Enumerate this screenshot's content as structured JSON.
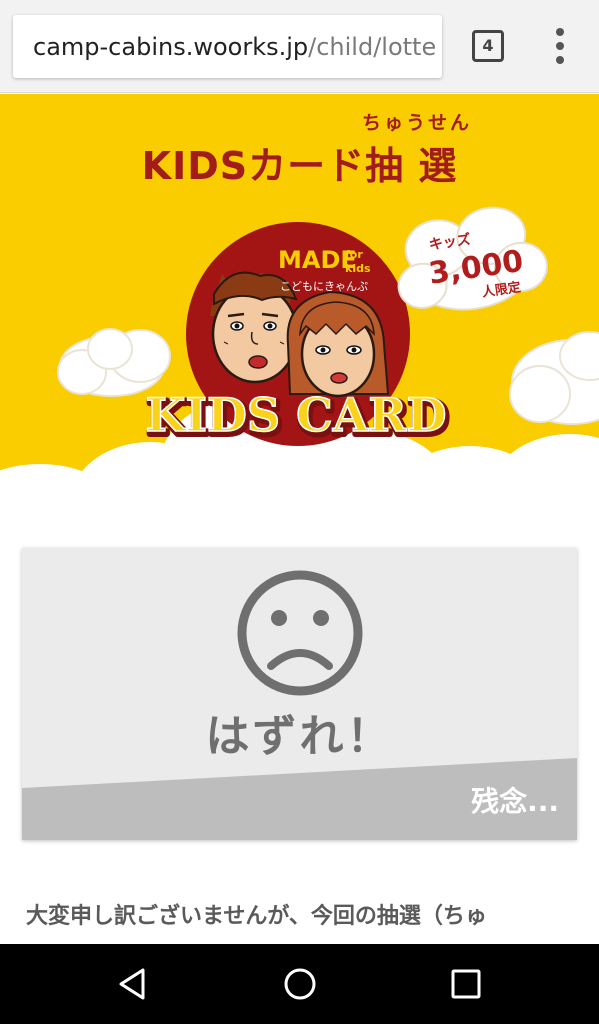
{
  "browser": {
    "url_host": "camp-cabins.woorks.jp",
    "url_path": "/child/lotte",
    "tab_count": "4"
  },
  "header": {
    "title": "KIDSカード抽 選",
    "title_ruby": "ちゅうせん"
  },
  "badge": {
    "made": "MADE",
    "for": "for",
    "kids": "kids",
    "kana": "こどもにきゃんぷ",
    "card_label": "KIDS CARD",
    "limit_top": "キッズ",
    "limit_number": "3,000",
    "limit_bottom": "人限定"
  },
  "result": {
    "title": "はずれ！",
    "subtitle": "残念..."
  },
  "body": {
    "message": "大変申し訳ございませんが、今回の抽選（ちゅ"
  },
  "icons": {
    "back": "back-triangle-icon",
    "home": "home-circle-icon",
    "recents": "recents-square-icon",
    "menu": "more-vert-icon",
    "sad": "sad-face-icon"
  },
  "colors": {
    "yellow": "#f9cd00",
    "brand_red": "#a21c1c",
    "gray_text": "#6f6f6f"
  }
}
